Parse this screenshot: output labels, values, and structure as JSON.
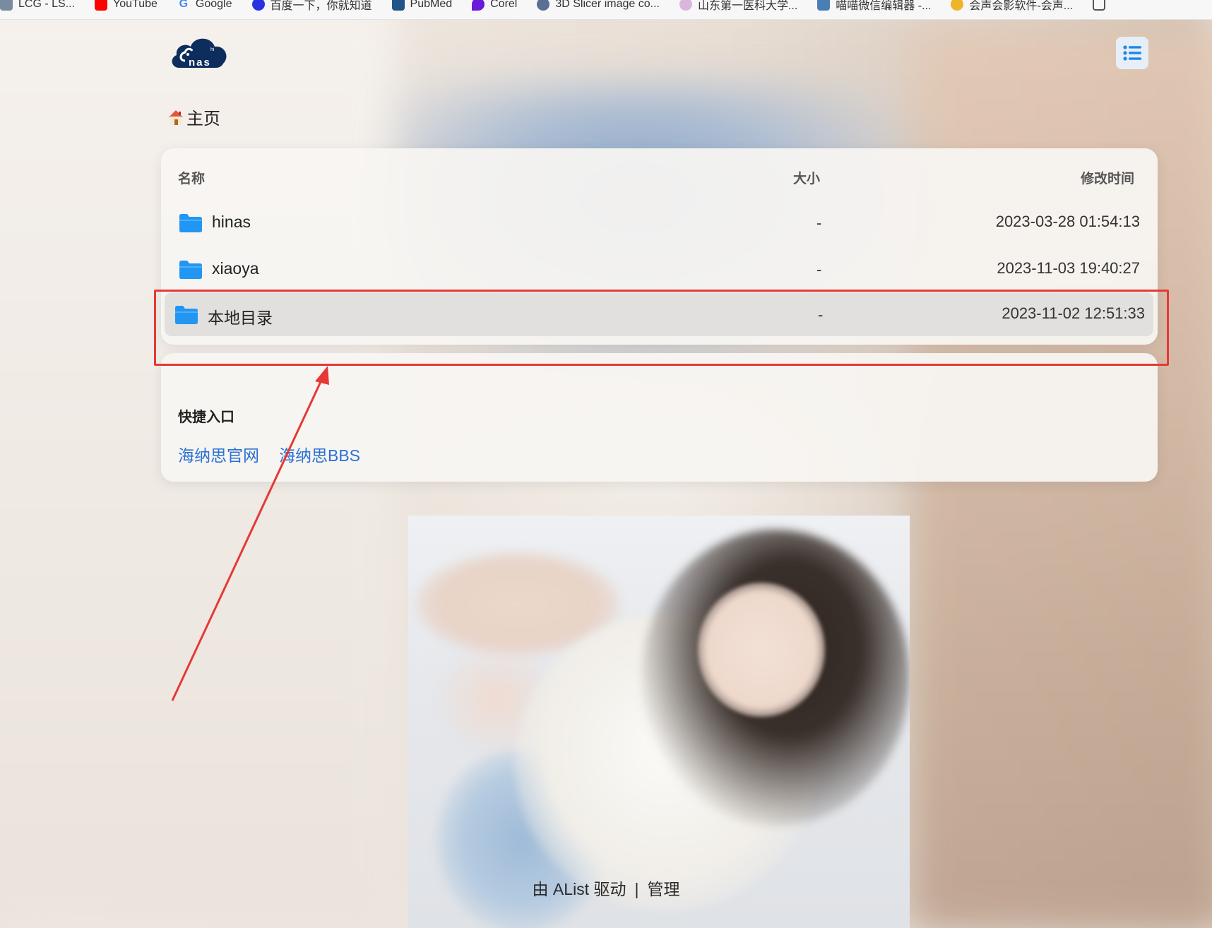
{
  "bookmarks": [
    {
      "label": "LCG - LS...",
      "icon": "page-icon",
      "color": "#7a8aa0"
    },
    {
      "label": "YouTube",
      "icon": "youtube-icon",
      "color": "#ff0000"
    },
    {
      "label": "Google",
      "icon": "google-icon",
      "color": "#4285f4"
    },
    {
      "label": "百度一下，你就知道",
      "icon": "baidu-icon",
      "color": "#2932e1"
    },
    {
      "label": "PubMed",
      "icon": "pubmed-icon",
      "color": "#20558a"
    },
    {
      "label": "Corel",
      "icon": "corel-icon",
      "color": "#6a1bd8"
    },
    {
      "label": "3D Slicer image co...",
      "icon": "slicer-icon",
      "color": "#5b6f95"
    },
    {
      "label": "山东第一医科大学...",
      "icon": "university-icon",
      "color": "#b07ab8"
    },
    {
      "label": "喵喵微信编辑器 -...",
      "icon": "editor-icon",
      "color": "#4a7fb5"
    },
    {
      "label": "会声会影软件-会声...",
      "icon": "video-icon",
      "color": "#f0b429"
    },
    {
      "label": "",
      "icon": "page-icon",
      "color": "#555555"
    }
  ],
  "header": {
    "logo_text": "nas",
    "logo_small": "hi",
    "menu_icon": "list-icon"
  },
  "breadcrumb": {
    "home_icon": "house-icon",
    "label": "主页"
  },
  "file_list": {
    "columns": {
      "name": "名称",
      "size": "大小",
      "modified": "修改时间"
    },
    "rows": [
      {
        "name": "hinas",
        "size": "-",
        "modified": "2023-03-28 01:54:13",
        "selected": false
      },
      {
        "name": "xiaoya",
        "size": "-",
        "modified": "2023-11-03 19:40:27",
        "selected": false
      },
      {
        "name": "本地目录",
        "size": "-",
        "modified": "2023-11-02 12:51:33",
        "selected": true
      }
    ]
  },
  "quick_links": {
    "title": "快捷入口",
    "links": [
      "海纳思官网",
      "海纳思BBS"
    ]
  },
  "footer": {
    "powered": "由 AList 驱动",
    "separator": "|",
    "admin": "管理"
  },
  "colors": {
    "accent": "#1e88e5",
    "folder": "#2196f3",
    "link": "#2b6fd6",
    "annotation": "#e53935"
  }
}
